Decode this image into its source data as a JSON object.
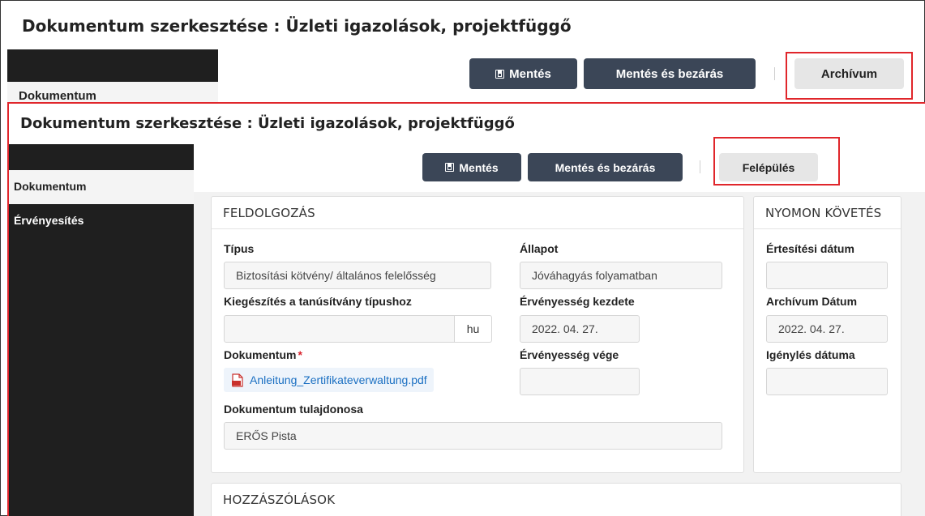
{
  "background_window": {
    "title": "Dokumentum szerkesztése : Üzleti igazolások, projektfüggő",
    "sidebar_tab": "Dokumentum",
    "buttons": {
      "save": "Mentés",
      "save_close": "Mentés és bezárás",
      "archive": "Archívum"
    }
  },
  "foreground_window": {
    "title": "Dokumentum szerkesztése : Üzleti igazolások, projektfüggő",
    "sidebar": {
      "items": [
        {
          "label": "Dokumentum",
          "active": true
        },
        {
          "label": "Érvényesítés",
          "active": false
        }
      ]
    },
    "buttons": {
      "save": "Mentés",
      "save_close": "Mentés és bezárás",
      "build": "Felépülés"
    },
    "processing_panel": {
      "title": "FELDOLGOZÁS",
      "type_label": "Típus",
      "type_value": "Biztosítási kötvény/ általános felelősség",
      "status_label": "Állapot",
      "status_value": "Jóváhagyás folyamatban",
      "supplement_label": "Kiegészítés a tanúsítvány típushoz",
      "supplement_value": "",
      "supplement_suffix": "hu",
      "valid_from_label": "Érvényesség kezdete",
      "valid_from_value": "2022. 04. 27.",
      "document_label": "Dokumentum",
      "document_required_mark": "*",
      "document_file": "Anleitung_Zertifikateverwaltung.pdf",
      "valid_to_label": "Érvényesség vége",
      "valid_to_value": "",
      "owner_label": "Dokumentum tulajdonosa",
      "owner_value": "ERŐS Pista"
    },
    "tracking_panel": {
      "title": "NYOMON KÖVETÉS",
      "notification_date_label": "Értesítési dátum",
      "notification_date_value": "",
      "archive_date_label": "Archívum Dátum",
      "archive_date_value": "2022. 04. 27.",
      "request_date_label": "Igénylés dátuma",
      "request_date_value": ""
    },
    "comments_panel": {
      "title": "HOZZÁSZÓLÁSOK"
    }
  },
  "colors": {
    "highlight": "#e0262b",
    "sidebar": "#1f1f1f",
    "dark_button": "#3b4657",
    "link": "#1a6fc2"
  }
}
